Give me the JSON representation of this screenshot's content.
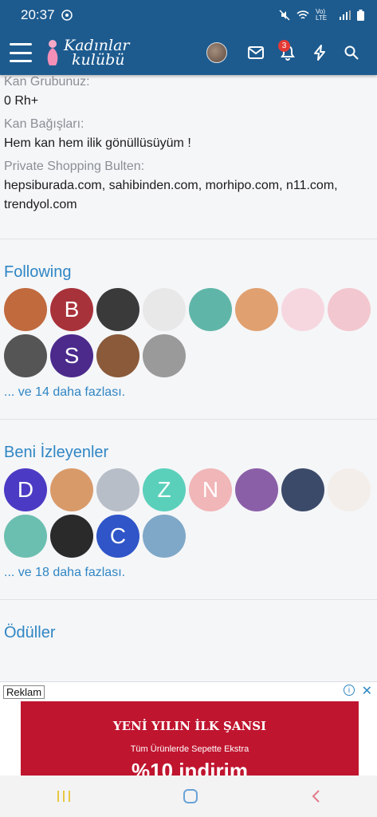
{
  "status": {
    "time": "20:37",
    "network": "Vo) LTE"
  },
  "header": {
    "logo_line1": "Kadınlar",
    "logo_line2": "kulübü",
    "alert_count": "3"
  },
  "profile": {
    "blood_label": "Kan Grubunuz:",
    "blood_value": "0 Rh+",
    "donation_label": "Kan Bağışları:",
    "donation_value": "Hem kan hem ilik gönüllüsüyüm !",
    "shopping_label": "Private Shopping Bulten:",
    "shopping_value": "hepsiburada.com, sahibinden.com, morhipo.com, n11.com, trendyol.com"
  },
  "following": {
    "title": "Following",
    "more": "... ve 14 daha fazlası.",
    "avatars": [
      {
        "letter": "",
        "color": "#c06a3e"
      },
      {
        "letter": "B",
        "color": "#a8323a"
      },
      {
        "letter": "",
        "color": "#3a3a3a"
      },
      {
        "letter": "",
        "color": "#e8e8e8"
      },
      {
        "letter": "",
        "color": "#5fb6a8"
      },
      {
        "letter": "",
        "color": "#e0a070"
      },
      {
        "letter": "",
        "color": "#f6d7e0"
      },
      {
        "letter": "",
        "color": "#f3c7cf"
      },
      {
        "letter": "",
        "color": "#555555"
      },
      {
        "letter": "S",
        "color": "#4b2a8c"
      },
      {
        "letter": "",
        "color": "#8a5a3a"
      },
      {
        "letter": "",
        "color": "#9a9a9a"
      }
    ]
  },
  "followers": {
    "title": "Beni İzleyenler",
    "more": "... ve 18 daha fazlası.",
    "avatars": [
      {
        "letter": "D",
        "color": "#4b3bc4"
      },
      {
        "letter": "",
        "color": "#d99a6a"
      },
      {
        "letter": "",
        "color": "#b8bec8"
      },
      {
        "letter": "Z",
        "color": "#5ad0bb"
      },
      {
        "letter": "N",
        "color": "#f1b6b8"
      },
      {
        "letter": "",
        "color": "#8b5fa8"
      },
      {
        "letter": "",
        "color": "#3c4a6a"
      },
      {
        "letter": "",
        "color": "#f4eeea"
      },
      {
        "letter": "",
        "color": "#6bbfb0"
      },
      {
        "letter": "",
        "color": "#2a2a2a"
      },
      {
        "letter": "C",
        "color": "#2f55c8"
      },
      {
        "letter": "",
        "color": "#7fa8c8"
      }
    ]
  },
  "awards": {
    "title": "Ödüller"
  },
  "ad": {
    "label": "Reklam",
    "headline": "YENİ YILIN İLK ŞANSI",
    "sub": "Tüm Ürünlerde Sepette Ekstra",
    "big": "%10 indirim"
  },
  "colors": {
    "primary": "#1d5b8f",
    "link": "#2f86c4",
    "ad_red": "#c0152f"
  }
}
